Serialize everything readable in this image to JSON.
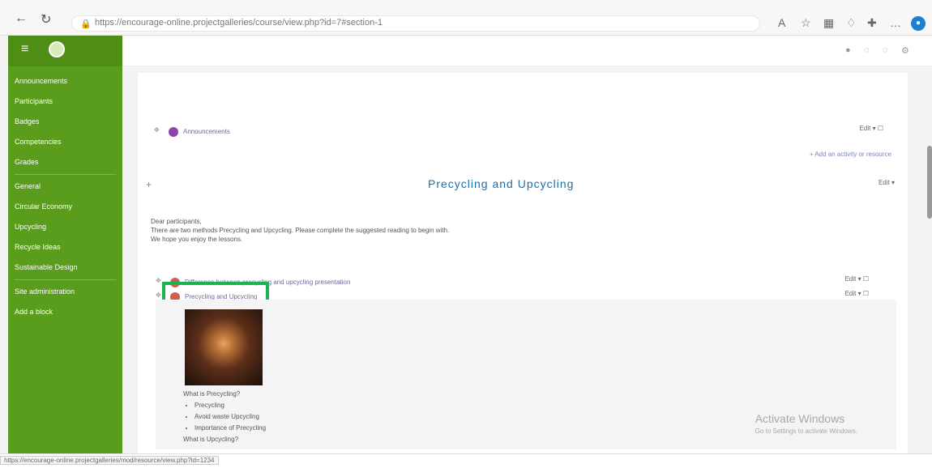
{
  "browser": {
    "url": "https://encourage-online.projectgalleries/course/view.php?id=7#section-1"
  },
  "sidebar": {
    "items": [
      "Announcements",
      "Participants",
      "Badges",
      "Competencies",
      "Grades",
      "General",
      "Circular Economy",
      "Upcycling",
      "Recycle Ideas",
      "Sustainable Design",
      "Site administration",
      "Add a block"
    ]
  },
  "course": {
    "activity1_label": "Announcements",
    "add_activity": "+ Add an activity or resource",
    "section_title": "Precycling and Upcycling",
    "description": [
      "Dear participants,",
      "There are two methods Precycling and Upcycling. Please complete the suggested reading to begin with.",
      "We hope you enjoy the lessons."
    ],
    "resource1": "Difference between precycling and upcycling presentation",
    "resource2": "Precycling and Upcycling",
    "content": {
      "heading1": "What is Precycling?",
      "list1": [
        "Precycling",
        "Avoid waste Upcycling",
        "Importance of Precycling"
      ],
      "heading2": "What is Upcycling?"
    }
  },
  "watermark": {
    "line1": "Activate Windows",
    "line2": "Go to Settings to activate Windows."
  },
  "status": {
    "url": "https://encourage-online.projectgalleries/mod/resource/view.php?id=1234"
  }
}
